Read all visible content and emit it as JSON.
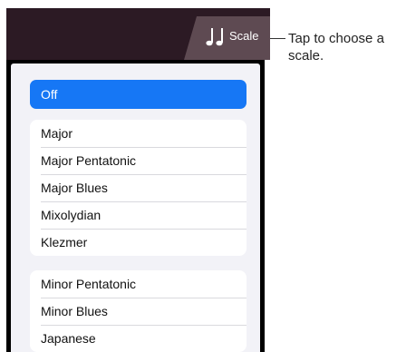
{
  "toolbar": {
    "scale_label": "Scale"
  },
  "callout": {
    "text": "Tap to choose a scale."
  },
  "scale_menu": {
    "off_label": "Off",
    "group1": [
      "Major",
      "Major Pentatonic",
      "Major Blues",
      "Mixolydian",
      "Klezmer"
    ],
    "group2": [
      "Minor Pentatonic",
      "Minor Blues",
      "Japanese"
    ]
  },
  "colors": {
    "accent": "#1677f5",
    "topbar": "#2c1a24",
    "scale_tab": "#5e4a52"
  },
  "icons": {
    "scale_icon": "music-notes-icon"
  }
}
